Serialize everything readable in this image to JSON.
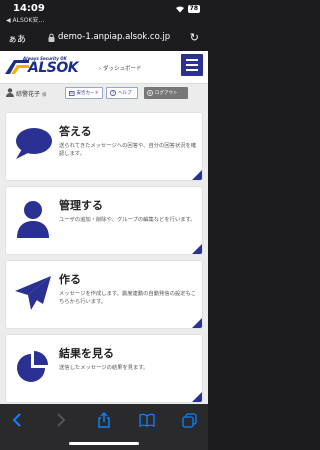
{
  "status": {
    "time": "14:09",
    "back_app": "◀ ALSOK安…",
    "battery": "78"
  },
  "browser": {
    "aa": "ぁあ",
    "url": "demo-1.anpiap.alsok.co.jp",
    "toolbar": [
      "back-icon",
      "forward-icon",
      "share-icon",
      "bookmarks-icon",
      "tabs-icon"
    ]
  },
  "header": {
    "tagline": "Always Security OK",
    "logo": "ALSOK",
    "subtitle": "ダッシュボード"
  },
  "user": {
    "name": "綜警花子",
    "suffix": "様",
    "buttons": {
      "card": "安否カード",
      "help": "ヘルプ",
      "logout": "ログアウト"
    }
  },
  "cards": [
    {
      "title": "答える",
      "desc": "送られてきたメッセージへの回答や、自分の回答状況を確認します。",
      "icon": "speech-bubble-icon"
    },
    {
      "title": "管理する",
      "desc": "ユーザの追加・削除や、グループの編集などを行います。",
      "icon": "person-icon"
    },
    {
      "title": "作る",
      "desc": "メッセージを作成します。震度連動の自動発信の設定もこちらから行います。",
      "icon": "paper-plane-icon"
    },
    {
      "title": "結果を見る",
      "desc": "送信したメッセージの結果を見ます。",
      "icon": "pie-chart-icon"
    }
  ],
  "colors": {
    "brand": "#2a3192",
    "browser_chrome": "#1c1c1e",
    "link_blue": "#0a84ff"
  }
}
